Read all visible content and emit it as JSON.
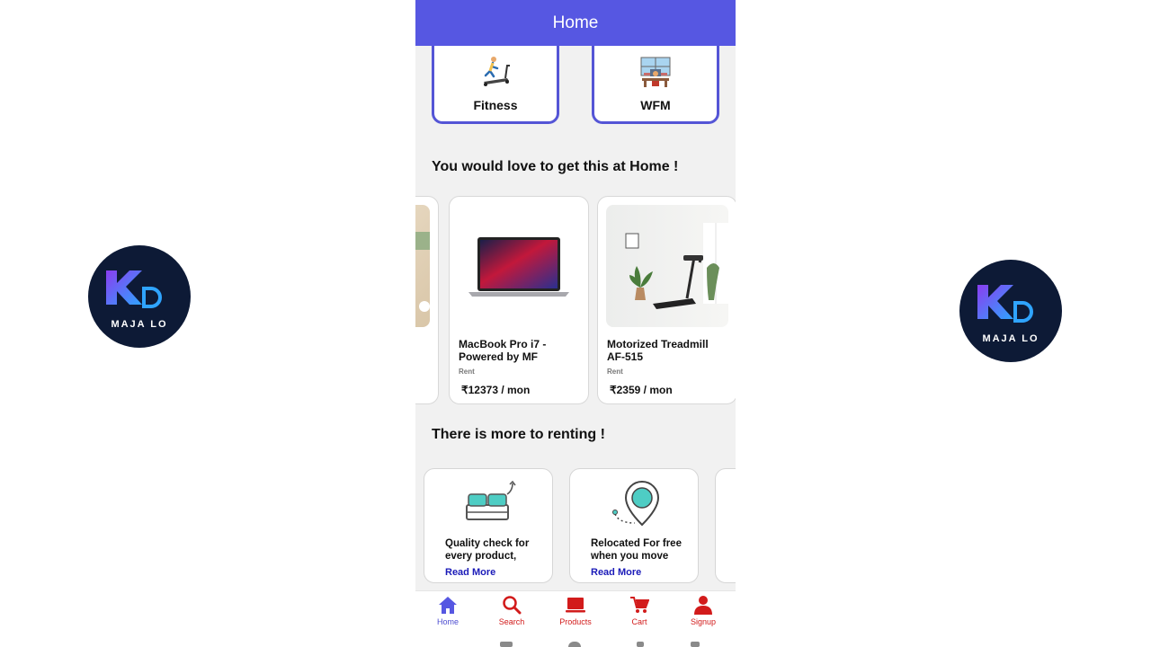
{
  "app": {
    "title": "Home",
    "accent": "#5657e2",
    "nav_active": "#4c4cd0",
    "nav_inactive": "#d21b1b"
  },
  "logo": {
    "text": "MAJA LO"
  },
  "categories": [
    {
      "label": "Fitness",
      "icon": "treadmill-icon"
    },
    {
      "label": "WFM",
      "icon": "workspace-icon"
    }
  ],
  "sections": {
    "products_title": "You would love to get this at Home !",
    "features_title": "There is  more to renting !"
  },
  "products": [
    {
      "name": "MacBook Pro i7 - Powered by MF",
      "type": "Rent",
      "price": "₹12373 / mon"
    },
    {
      "name": "Motorized Treadmill AF-515",
      "type": "Rent",
      "price": "₹2359 / mon"
    }
  ],
  "features": [
    {
      "text": "Quality check for every product,",
      "link": "Read More",
      "icon": "bed-upgrade-icon"
    },
    {
      "text": "Relocated For free when you move",
      "link": "Read More",
      "icon": "location-pin-icon"
    }
  ],
  "bottom_nav": [
    {
      "label": "Home",
      "icon": "home-icon",
      "active": true
    },
    {
      "label": "Search",
      "icon": "search-icon",
      "active": false
    },
    {
      "label": "Products",
      "icon": "laptop-icon",
      "active": false
    },
    {
      "label": "Cart",
      "icon": "cart-icon",
      "active": false
    },
    {
      "label": "Signup",
      "icon": "user-icon",
      "active": false
    }
  ]
}
